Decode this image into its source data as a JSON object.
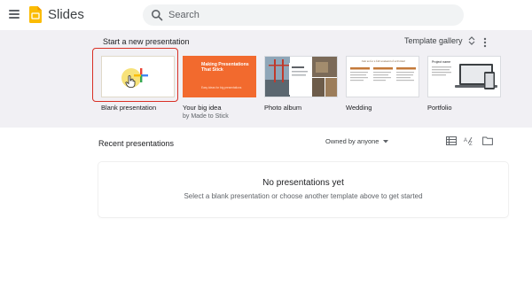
{
  "app": {
    "name": "Slides",
    "brand_color": "#FBBC04"
  },
  "search": {
    "placeholder": "Search"
  },
  "templates_section": {
    "title": "Start a new presentation",
    "gallery_label": "Template gallery",
    "items": [
      {
        "name": "Blank presentation",
        "subtitle": ""
      },
      {
        "name": "Your big idea",
        "subtitle": "by Made to Stick",
        "thumb_title": "Making Presentations That Stick",
        "thumb_subtitle": "Easy ideas for big presentations"
      },
      {
        "name": "Photo album",
        "subtitle": ""
      },
      {
        "name": "Wedding",
        "subtitle": "",
        "thumb_title": "Join us for a fall weekend of activities!"
      },
      {
        "name": "Portfolio",
        "subtitle": "",
        "thumb_title": "Project name"
      }
    ],
    "selected_index": 0,
    "selected_color": "#D93025"
  },
  "recent": {
    "title": "Recent presentations",
    "filter_label": "Owned by anyone",
    "empty_title": "No presentations yet",
    "empty_subtitle": "Select a blank presentation or choose another template above to get started"
  },
  "colors": {
    "section_bg": "#F1F0F4",
    "accent_orange": "#F26A2E"
  }
}
